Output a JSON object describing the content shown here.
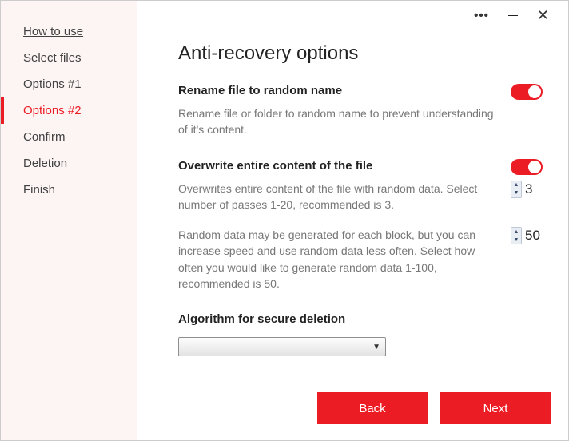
{
  "titlebar": {
    "more": "•••",
    "close": "✕"
  },
  "sidebar": {
    "items": [
      {
        "label": "How to use"
      },
      {
        "label": "Select files"
      },
      {
        "label": "Options #1"
      },
      {
        "label": "Options #2"
      },
      {
        "label": "Confirm"
      },
      {
        "label": "Deletion"
      },
      {
        "label": "Finish"
      }
    ]
  },
  "page": {
    "title": "Anti-recovery options",
    "rename": {
      "heading": "Rename file to random name",
      "desc": "Rename file or folder to random name to prevent understanding of it's content."
    },
    "overwrite": {
      "heading": "Overwrite entire content of the file",
      "passes_desc": "Overwrites entire content of the file with random data. Select number of passes 1-20, recommended is 3.",
      "passes_value": "3",
      "random_desc": "Random data may be generated for each block, but you can increase speed and use random data less often. Select how often you would like to generate random data 1-100, recommended is 50.",
      "random_value": "50"
    },
    "algorithm": {
      "heading": "Algorithm for secure deletion",
      "selected": "-"
    }
  },
  "footer": {
    "back": "Back",
    "next": "Next"
  }
}
